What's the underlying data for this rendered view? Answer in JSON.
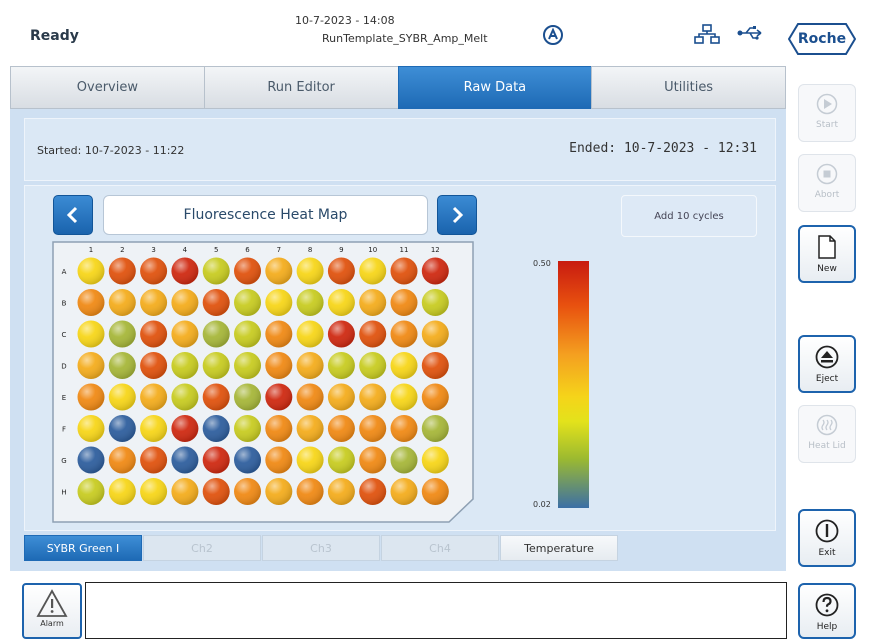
{
  "header": {
    "status": "Ready",
    "datetime": "10-7-2023 - 14:08",
    "run_name": "RunTemplate_SYBR_Amp_Melt",
    "brand": "Roche"
  },
  "tabs": [
    {
      "label": "Overview",
      "active": false
    },
    {
      "label": "Run Editor",
      "active": false
    },
    {
      "label": "Raw Data",
      "active": true
    },
    {
      "label": "Utilities",
      "active": false
    }
  ],
  "run_info": {
    "started": "Started: 10-7-2023 - 11:22",
    "ended": "Ended: 10-7-2023 - 12:31"
  },
  "heatmap": {
    "title": "Fluorescence Heat Map",
    "add_cycles_label": "Add 10 cycles",
    "colorbar_max": "0.50",
    "colorbar_min": "0.02",
    "columns": [
      "1",
      "2",
      "3",
      "4",
      "5",
      "6",
      "7",
      "8",
      "9",
      "10",
      "11",
      "12"
    ],
    "rows": [
      "A",
      "B",
      "C",
      "D",
      "E",
      "F",
      "G",
      "H"
    ],
    "colors": {
      "red": "#cf2a12",
      "dark_orange": "#e0530f",
      "orange": "#f08a16",
      "light_orange": "#f4ad1e",
      "yellow": "#f7d61a",
      "yellow_green": "#c8cc22",
      "olive": "#a7b73a",
      "blue": "#2f5f9e"
    },
    "wells": [
      [
        "yellow",
        "dark_orange",
        "dark_orange",
        "red",
        "yellow_green",
        "dark_orange",
        "light_orange",
        "yellow",
        "dark_orange",
        "yellow",
        "dark_orange",
        "red"
      ],
      [
        "orange",
        "light_orange",
        "light_orange",
        "light_orange",
        "dark_orange",
        "yellow_green",
        "yellow",
        "yellow_green",
        "yellow",
        "light_orange",
        "orange",
        "yellow_green"
      ],
      [
        "yellow",
        "olive",
        "dark_orange",
        "light_orange",
        "olive",
        "yellow_green",
        "orange",
        "yellow",
        "red",
        "dark_orange",
        "orange",
        "light_orange"
      ],
      [
        "light_orange",
        "olive",
        "dark_orange",
        "yellow_green",
        "yellow_green",
        "yellow_green",
        "orange",
        "light_orange",
        "yellow_green",
        "yellow_green",
        "yellow",
        "dark_orange"
      ],
      [
        "orange",
        "yellow",
        "light_orange",
        "yellow_green",
        "dark_orange",
        "olive",
        "red",
        "orange",
        "light_orange",
        "light_orange",
        "yellow",
        "orange"
      ],
      [
        "yellow",
        "blue",
        "yellow",
        "red",
        "blue",
        "yellow_green",
        "orange",
        "light_orange",
        "orange",
        "orange",
        "orange",
        "olive"
      ],
      [
        "blue",
        "orange",
        "dark_orange",
        "blue",
        "red",
        "blue",
        "orange",
        "yellow",
        "yellow_green",
        "orange",
        "olive",
        "yellow"
      ],
      [
        "yellow_green",
        "yellow",
        "yellow",
        "light_orange",
        "dark_orange",
        "orange",
        "light_orange",
        "orange",
        "light_orange",
        "dark_orange",
        "light_orange",
        "orange"
      ]
    ]
  },
  "channels": [
    {
      "label": "SYBR Green I",
      "state": "active"
    },
    {
      "label": "Ch2",
      "state": "disabled"
    },
    {
      "label": "Ch3",
      "state": "disabled"
    },
    {
      "label": "Ch4",
      "state": "disabled"
    },
    {
      "label": "Temperature",
      "state": "enabled"
    }
  ],
  "side_buttons": [
    {
      "label": "Start",
      "icon": "play-icon",
      "enabled": false
    },
    {
      "label": "Abort",
      "icon": "stop-icon",
      "enabled": false
    },
    {
      "label": "New",
      "icon": "new-document-icon",
      "enabled": true
    },
    {
      "label": "Eject",
      "icon": "eject-icon",
      "enabled": true
    },
    {
      "label": "Heat Lid",
      "icon": "heat-icon",
      "enabled": false
    },
    {
      "label": "Exit",
      "icon": "power-icon",
      "enabled": true
    },
    {
      "label": "Help",
      "icon": "help-icon",
      "enabled": true
    }
  ],
  "alarm": {
    "label": "Alarm",
    "icon": "warning-icon"
  },
  "message": ""
}
